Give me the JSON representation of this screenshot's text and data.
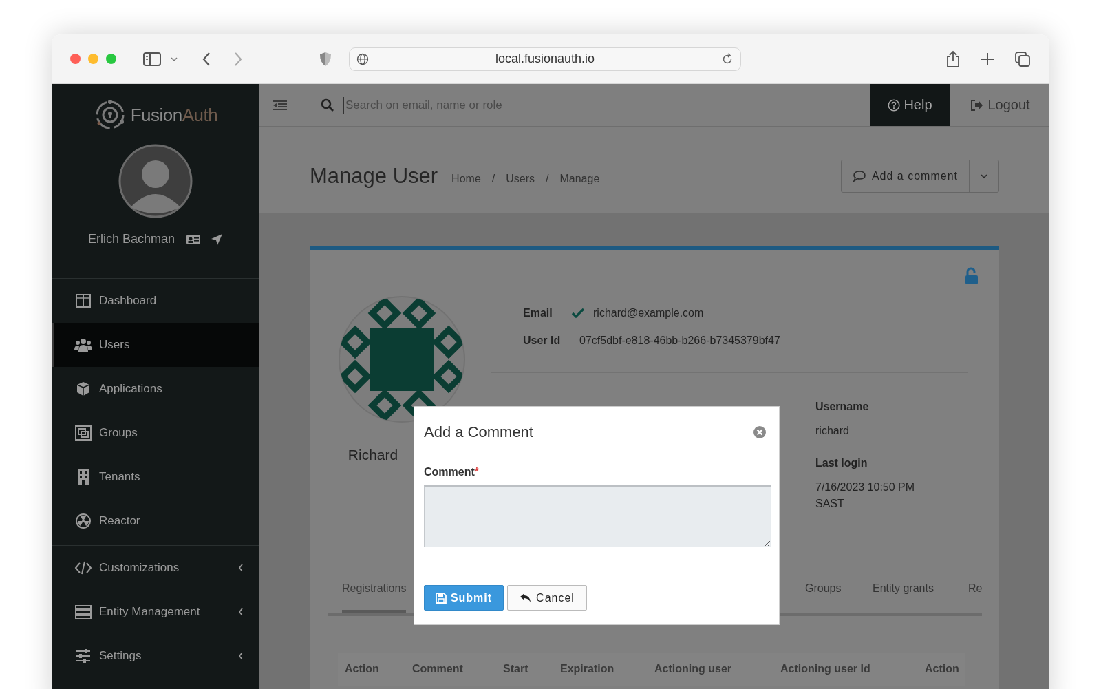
{
  "browser": {
    "url": "local.fusionauth.io"
  },
  "sidebar": {
    "brand": {
      "first": "Fusion",
      "second": "Auth"
    },
    "user_name": "Erlich Bachman",
    "items": [
      {
        "label": "Dashboard",
        "selected": false,
        "expandable": false
      },
      {
        "label": "Users",
        "selected": true,
        "expandable": false
      },
      {
        "label": "Applications",
        "selected": false,
        "expandable": false
      },
      {
        "label": "Groups",
        "selected": false,
        "expandable": false
      },
      {
        "label": "Tenants",
        "selected": false,
        "expandable": false
      },
      {
        "label": "Reactor",
        "selected": false,
        "expandable": false
      },
      {
        "label": "Customizations",
        "selected": false,
        "expandable": true
      },
      {
        "label": "Entity Management",
        "selected": false,
        "expandable": true
      },
      {
        "label": "Settings",
        "selected": false,
        "expandable": true
      }
    ]
  },
  "header": {
    "search": {
      "placeholder": "Search on email, name or role"
    },
    "help": "Help",
    "logout": "Logout"
  },
  "page": {
    "title": "Manage User",
    "breadcrumbs": [
      "Home",
      "Users",
      "Manage"
    ],
    "separator": "/",
    "action_button": "Add a comment"
  },
  "user": {
    "name": "Richard",
    "locked": false,
    "fields": [
      {
        "label": "Email",
        "value": "richard@example.com",
        "verified": true
      },
      {
        "label": "User Id",
        "value": "07cf5dbf-e818-46bb-b266-b7345379bf47",
        "verified": false
      }
    ],
    "details": [
      {
        "label": "Username",
        "value": "richard"
      },
      {
        "label": "Last login",
        "value": "7/16/2023 10:50 PM SAST"
      }
    ]
  },
  "tabs": [
    {
      "label": "Registrations",
      "selected": true
    },
    {
      "label": "Groups",
      "selected": false
    },
    {
      "label": "Entity grants",
      "selected": false
    },
    {
      "label": "Re",
      "selected": false
    }
  ],
  "table": {
    "columns": [
      "Action",
      "Comment",
      "Start",
      "Expiration",
      "Actioning user",
      "Actioning user Id",
      "Action"
    ]
  },
  "modal": {
    "title": "Add a Comment",
    "field_label": "Comment",
    "required_mark": "*",
    "submit": "Submit",
    "cancel": "Cancel"
  }
}
